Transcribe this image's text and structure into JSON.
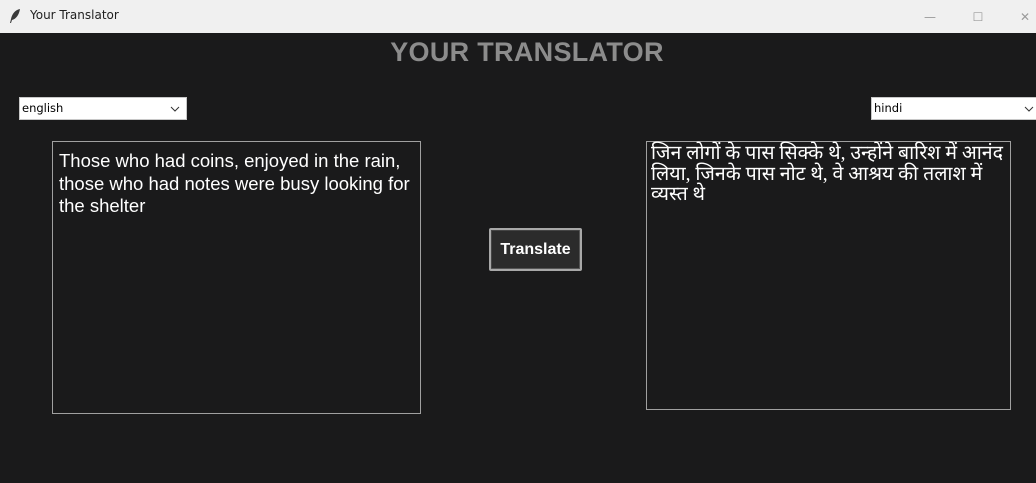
{
  "window": {
    "title": "Your Translator",
    "minimize_glyph": "—",
    "maximize_glyph": "☐",
    "close_glyph": "✕"
  },
  "app": {
    "heading": "YOUR TRANSLATOR",
    "source_language": "english",
    "target_language": "hindi",
    "source_text": "Those who had coins, enjoyed in the rain, those who had notes were busy looking for the shelter",
    "translated_text": "जिन लोगों के पास सिक्के थे, उन्होंने बारिश में आनंद लिया, जिनके पास नोट थे, वे आश्रय की तलाश में व्यस्त थे",
    "translate_button": "Translate"
  },
  "colors": {
    "background": "#1a1a1b",
    "titlebar": "#f0f0f0",
    "heading": "#8c8c8c",
    "text": "#ffffff"
  },
  "icons": {
    "app": "feather-icon",
    "dropdown": "chevron-down-icon"
  }
}
